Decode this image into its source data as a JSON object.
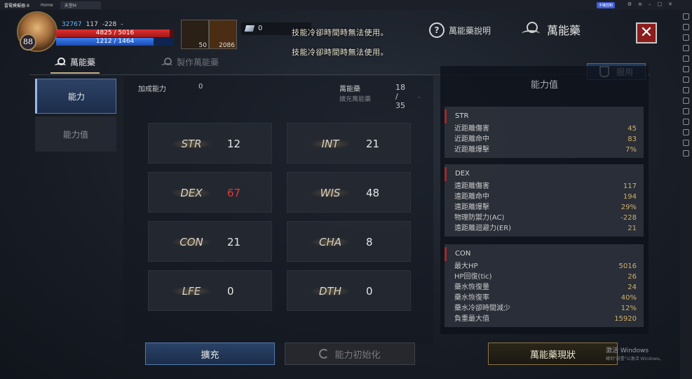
{
  "emulator": {
    "brand": "雷電模擬器-9",
    "tabs": [
      "Home",
      "天堂M"
    ],
    "promo": "手機控制"
  },
  "hud": {
    "level": "88",
    "power": "32767",
    "stat_a": "117",
    "stat_b": "-228",
    "stat_c": "-",
    "hp": "4825 / 5016",
    "hp_fraction": 0.962,
    "mp": "1212 / 1464",
    "mp_fraction": 0.828,
    "buff1_count": "50",
    "buff2_count": "2086",
    "crystal_count": "0",
    "warnings": [
      "技能冷卻時間時無法使用。",
      "技能冷卻時間時無法使用。"
    ],
    "help_label": "萬能藥說明",
    "title": "萬能藥"
  },
  "tabs": {
    "main": "萬能藥",
    "craft": "製作萬能藥",
    "use_label": "服用"
  },
  "nav": {
    "ability": "能力",
    "stats": "能力值"
  },
  "center": {
    "bonus_label": "加成能力",
    "bonus_value": "0",
    "potion_label": "萬能藥",
    "potion_count": "18 / 35",
    "expand_range_label": "擴充萬能藥",
    "expand_range_value": "-"
  },
  "stats": [
    {
      "name": "STR",
      "value": "12",
      "color": "#e6e6e6"
    },
    {
      "name": "INT",
      "value": "21",
      "color": "#e6e6e6"
    },
    {
      "name": "DEX",
      "value": "67",
      "color": "#e33a3a"
    },
    {
      "name": "WIS",
      "value": "48",
      "color": "#e6e6e6"
    },
    {
      "name": "CON",
      "value": "21",
      "color": "#e6e6e6"
    },
    {
      "name": "CHA",
      "value": "8",
      "color": "#e6e6e6"
    },
    {
      "name": "LFE",
      "value": "0",
      "color": "#e6e6e6"
    },
    {
      "name": "DTH",
      "value": "0",
      "color": "#e6e6e6"
    }
  ],
  "right_panel": {
    "title": "能力值",
    "sections": [
      {
        "name": "STR",
        "rows": [
          [
            "近距離傷害",
            "45"
          ],
          [
            "近距離命中",
            "83"
          ],
          [
            "近距離爆擊",
            "7%"
          ]
        ]
      },
      {
        "name": "DEX",
        "rows": [
          [
            "遠距離傷害",
            "117"
          ],
          [
            "遠距離命中",
            "194"
          ],
          [
            "遠距離爆擊",
            "29%"
          ],
          [
            "物理防禦力(AC)",
            "-228"
          ],
          [
            "遠距離迴避力(ER)",
            "21"
          ]
        ]
      },
      {
        "name": "CON",
        "rows": [
          [
            "最大HP",
            "5016"
          ],
          [
            "HP回復(tic)",
            "26"
          ],
          [
            "藥水恢復量",
            "24"
          ],
          [
            "藥水恢復率",
            "40%"
          ],
          [
            "藥水冷卻時間減少",
            "12%"
          ],
          [
            "負重最大值",
            "15920"
          ]
        ]
      }
    ]
  },
  "buttons": {
    "expand": "擴充",
    "reset": "能力初始化",
    "status": "萬能藥現狀"
  },
  "watermark": {
    "line1": "激活 Windows",
    "line2": "轉到\"設置\"以激活 Windows。"
  }
}
